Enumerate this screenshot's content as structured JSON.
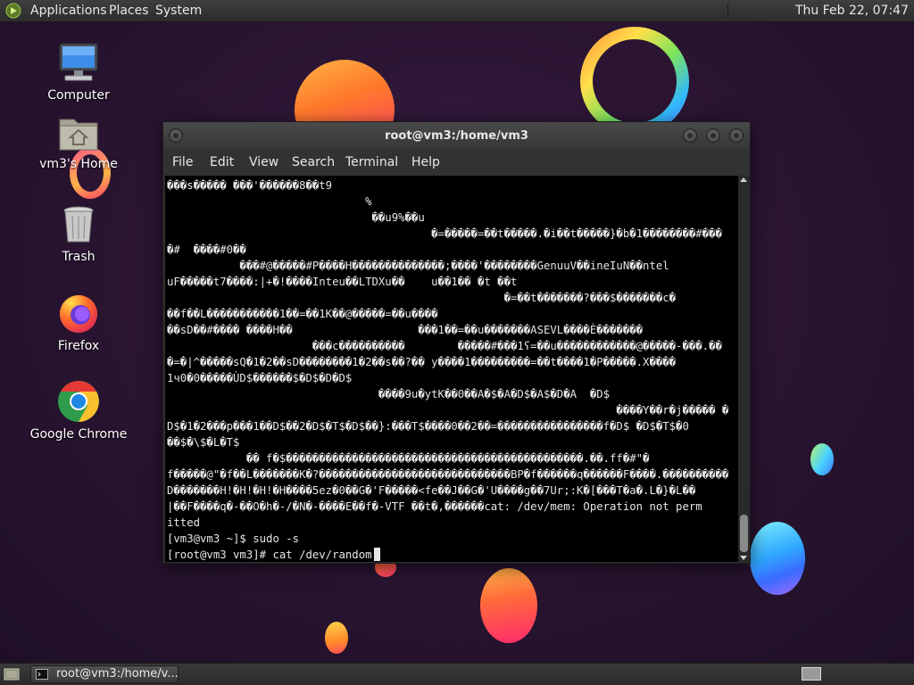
{
  "top_panel": {
    "menus": {
      "applications": "Applications",
      "places": "Places",
      "system": "System"
    },
    "clock": "Thu Feb 22, 07:47"
  },
  "desktop_icons": [
    {
      "label": "Computer",
      "icon": "computer-icon"
    },
    {
      "label": "vm3's Home",
      "icon": "home-folder-icon"
    },
    {
      "label": "Trash",
      "icon": "trash-icon"
    },
    {
      "label": "Firefox",
      "icon": "firefox-icon"
    },
    {
      "label": "Google Chrome",
      "icon": "chrome-icon"
    }
  ],
  "terminal": {
    "title": "root@vm3:/home/vm3",
    "menu": {
      "file": "File",
      "edit": "Edit",
      "view": "View",
      "search": "Search",
      "terminal": "Terminal",
      "help": "Help"
    },
    "lines": [
      "���s����� ���'������8��t9",
      "                              %",
      "                               ��u9%��u",
      "                                        �=�����=��t�����.�i��t�����}�b�1��������#���",
      "�#  ����#0��",
      "           ���#@�����#P����H��������������;����'��������GenuuV��ineIuN��ntel",
      "uF�����t7����:|+�!����Inteu��LTDXu��    u��1�� �t ��t",
      "                                                   �=��t�������?���$�������c�",
      "��f��L�����������1��=��1K��@�����=��u����",
      "��sD��#���� ����H��                   ���1��=��u�������ASEVL����È�������",
      "                      ���c����������        �����#���1ʕ=��u������������@�����-���.��",
      "�=�|^�����sQ�1�2��sD��������1�2��s��?�� y����1���������=��t����1�P�����.X����",
      "1ч0�0�����ÙD$������$�D$�D�D$",
      "                                ����9u�ytK��0��A�$�A�D$�A$�D�A  �D$",
      "                                                                    ����Y��r�j����� �",
      "D$�1�2���p���1��D$��2�D$�T$�D$��}:���T$����0��2��=����������������f�D$ �D$�T$�0",
      "��$�\\$�L�T$",
      "            �� f�$���������������������������������������������.��.ff�#\"�",
      "f�����@\"�f��L�������K�?�����������������������������BP�f������q������F����.����������",
      "D�������H!�H!�H!�H����5ez�0��G�'F�����<fe��J��G�'U����g��7Ur;:K�[���T�a�.L�}�L��",
      "|��F����q�-��O�h�-/�N�-����E��f�-VTF ��t�,������cat: /dev/mem: Operation not perm",
      "itted",
      "[vm3@vm3 ~]$ sudo -s",
      "[root@vm3 vm3]# cat /dev/random"
    ]
  },
  "taskbar": {
    "task_label": "root@vm3:/home/v..."
  }
}
